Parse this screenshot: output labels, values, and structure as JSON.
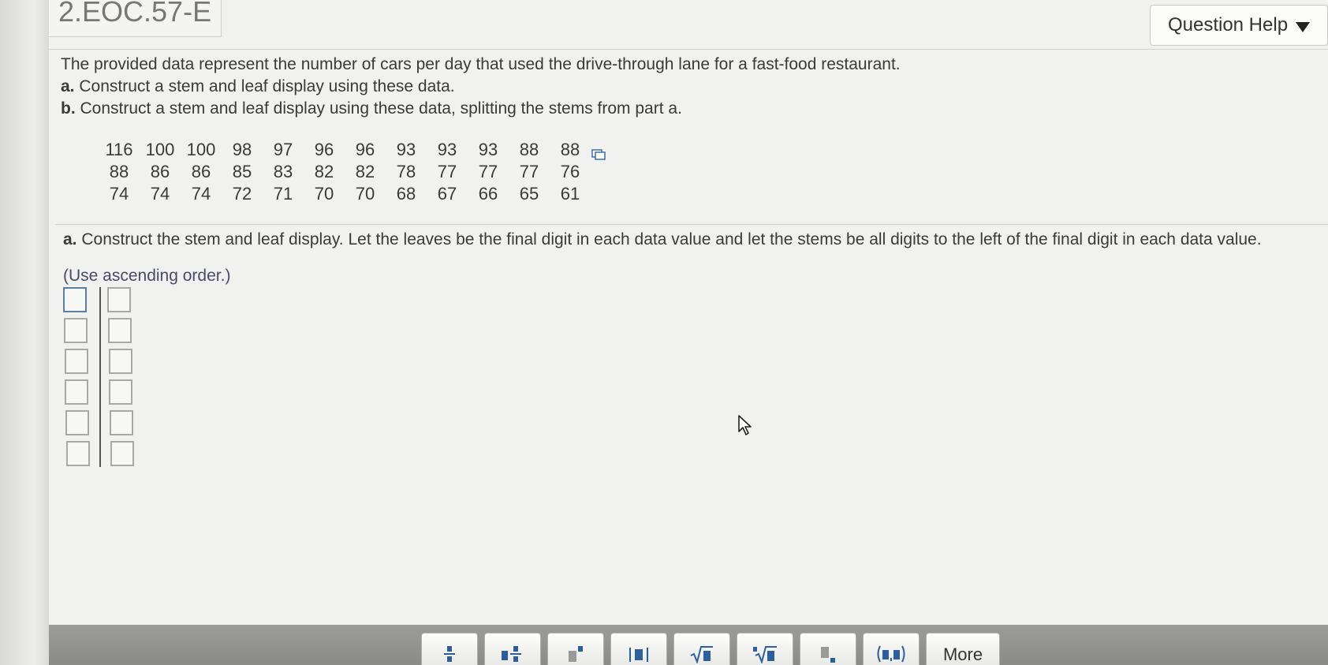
{
  "header": {
    "problem_id": "2.EOC.57-E",
    "question_help_label": "Question Help"
  },
  "problem": {
    "intro": "The provided data represent the number of cars per day that used the drive-through lane for a fast-food restaurant.",
    "part_a_label": "a.",
    "part_a_text": "Construct a stem and leaf display using these data.",
    "part_b_label": "b.",
    "part_b_text": "Construct a stem and leaf display using these data, splitting the stems from part a."
  },
  "data_rows": [
    [
      "116",
      "100",
      "100",
      "98",
      "97",
      "96",
      "96",
      "93",
      "93",
      "93",
      "88",
      "88"
    ],
    [
      "88",
      "86",
      "86",
      "85",
      "83",
      "82",
      "82",
      "78",
      "77",
      "77",
      "77",
      "76"
    ],
    [
      "74",
      "74",
      "74",
      "72",
      "71",
      "70",
      "70",
      "68",
      "67",
      "66",
      "65",
      "61"
    ]
  ],
  "part_a": {
    "label": "a.",
    "instruction": "Construct the stem and leaf display. Let the leaves be the final digit in each data value and let the stems be all digits to the left of the final digit in each data value.",
    "hint": "(Use ascending order.)"
  },
  "stem_leaf": {
    "rows": 6,
    "stems": [
      "",
      "",
      "",
      "",
      "",
      ""
    ],
    "leaves": [
      "",
      "",
      "",
      "",
      "",
      ""
    ]
  },
  "toolbar": {
    "more_label": "More"
  }
}
